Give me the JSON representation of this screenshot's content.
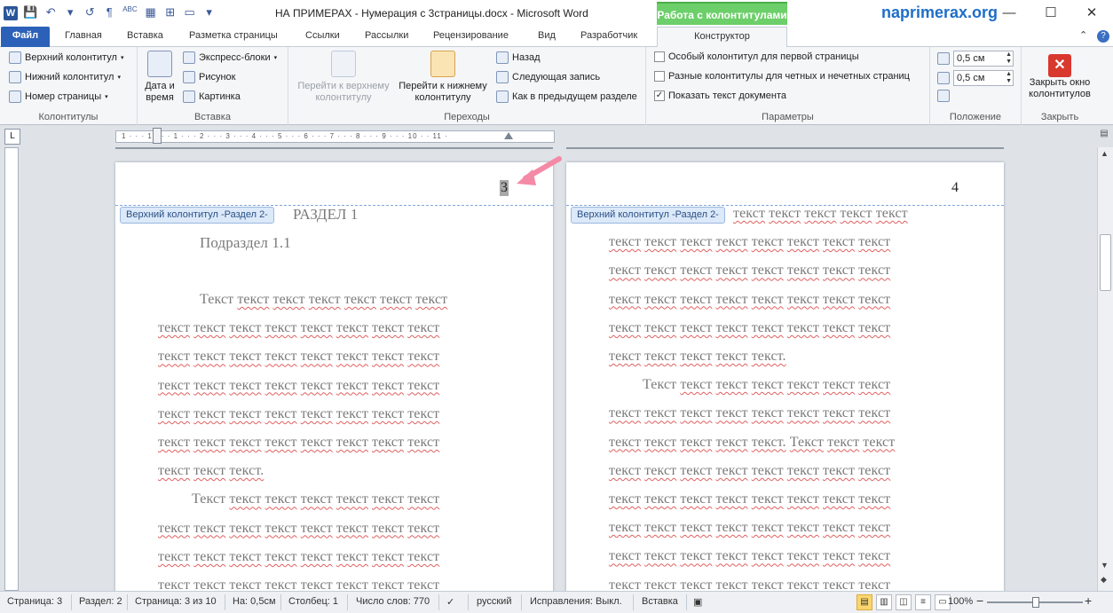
{
  "title_bar": {
    "app_letter": "W",
    "qat": [
      "💾",
      "↶",
      "▾",
      "↺",
      "¶",
      "ABC",
      "▦",
      "⊞",
      "▭",
      "▾"
    ],
    "title": "НА ПРИМЕРАХ - Нумерация с 3страницы.docx  -  Microsoft Word",
    "context_tab_title": "Работа с колонтитулами",
    "site": "naprimerax.org",
    "minimize": "—",
    "maximize": "☐",
    "close": "✕"
  },
  "tabs": {
    "file": "Файл",
    "items": [
      "Главная",
      "Вставка",
      "Разметка страницы",
      "Ссылки",
      "Рассылки",
      "Рецензирование",
      "Вид",
      "Разработчик"
    ],
    "active": "Конструктор",
    "help": "?",
    "collapse": "⌃"
  },
  "ribbon": {
    "g_kolontituly": {
      "label": "Колонтитулы",
      "header": "Верхний колонтитул",
      "footer": "Нижний колонтитул",
      "page_number": "Номер страницы"
    },
    "g_insert": {
      "label": "Вставка",
      "date_time": "Дата и время",
      "express": "Экспресс-блоки",
      "picture": "Рисунок",
      "clipart": "Картинка"
    },
    "g_nav": {
      "label": "Переходы",
      "goto_header": "Перейти к верхнему колонтитулу",
      "goto_footer": "Перейти к нижнему колонтитулу",
      "back": "Назад",
      "next": "Следующая запись",
      "link_prev": "Как в предыдущем разделе"
    },
    "g_params": {
      "label": "Параметры",
      "opt_first": "Особый колонтитул для первой страницы",
      "opt_odd_even": "Разные колонтитулы для четных и нечетных страниц",
      "opt_show_text": "Показать текст документа",
      "check_mark": "✓"
    },
    "g_pos": {
      "label": "Положение",
      "top_value": "0,5 см",
      "bottom_value": "0,5 см"
    },
    "g_close": {
      "label": "Закрыть",
      "close_btn": "Закрыть окно колонтитулов",
      "x": "✕"
    }
  },
  "ruler": {
    "tab_selector": "L",
    "ticks": "1 · · · 1 · · · 1 · · · 2 · · · 3 · · · 4 · · · 5 · · · 6 · · · 7 · · · 8 · · · 9 · · · 10 · · 11 ·"
  },
  "pages": {
    "header_tag": "Верхний колонтитул -Раздел 2-",
    "p1": {
      "page_num": "3",
      "heading": "РАЗДЕЛ 1",
      "subheading": "Подраздел 1.1",
      "lines": [
        "Текст текст текст текст текст текст текст",
        "текст текст текст текст текст текст текст текст",
        "текст текст текст текст текст текст текст текст",
        "текст текст текст текст текст текст текст текст",
        "текст текст текст текст текст текст текст текст",
        "текст текст текст текст текст текст текст текст",
        "текст текст текст.",
        "Текст текст текст текст текст текст текст",
        "текст текст текст текст текст текст текст текст",
        "текст текст текст текст текст текст текст текст",
        "текст текст текст текст текст текст текст текст"
      ]
    },
    "p2": {
      "page_num": "4",
      "lines": [
        "текст текст текст текст текст",
        "текст текст текст текст текст текст текст текст",
        "текст текст текст текст текст текст текст текст",
        "текст текст текст текст текст текст текст текст",
        "текст текст текст текст текст текст текст текст",
        "текст текст текст текст текст.",
        "Текст текст текст текст текст текст текст",
        "текст текст текст текст текст текст текст текст",
        "текст текст текст текст текст. Текст текст текст",
        "текст текст текст текст текст текст текст текст",
        "текст текст текст текст текст текст текст текст",
        "текст текст текст текст текст текст текст текст",
        "текст текст текст текст текст текст текст текст",
        "текст текст текст текст текст текст текст текст"
      ]
    }
  },
  "status": {
    "page": "Страница: 3",
    "section": "Раздел: 2",
    "page_of": "Страница: 3 из 10",
    "at": "На: 0,5см",
    "column": "Столбец: 1",
    "words": "Число слов: 770",
    "lang": "русский",
    "track": "Исправления: Выкл.",
    "insert": "Вставка",
    "zoom": "100%",
    "zoom_minus": "−",
    "zoom_plus": "+"
  },
  "colors": {
    "accent": "#2b61b8",
    "context_green": "#6ccf6a",
    "arrow_pink": "#f48aa6"
  }
}
